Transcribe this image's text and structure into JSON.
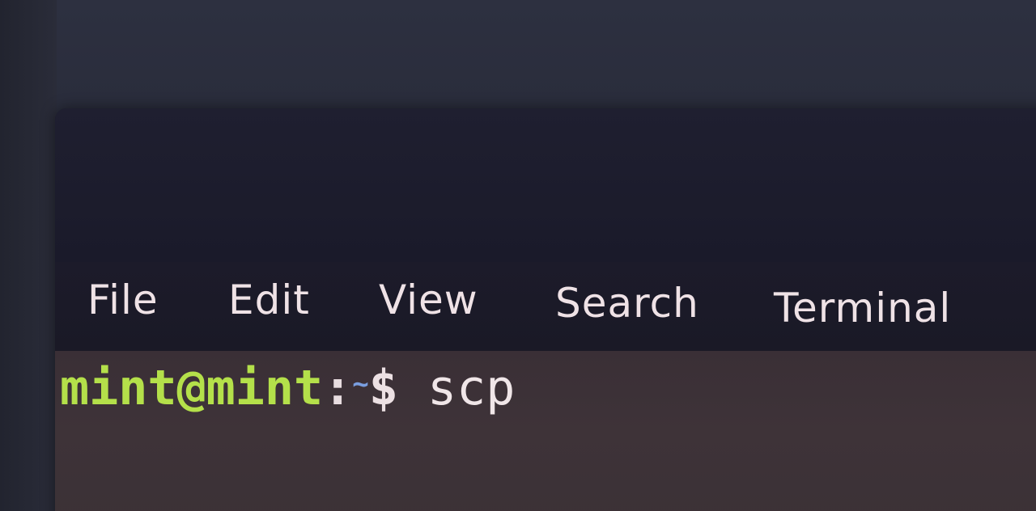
{
  "menu": {
    "items": [
      {
        "label": "File"
      },
      {
        "label": "Edit"
      },
      {
        "label": "View"
      },
      {
        "label": "Search"
      },
      {
        "label": "Terminal"
      }
    ]
  },
  "terminal": {
    "prompt_user_host": "mint@mint",
    "prompt_separator": ":",
    "prompt_path": "~",
    "prompt_symbol": "$",
    "command": "scp"
  },
  "colors": {
    "prompt_user": "#b4e04a",
    "prompt_path": "#7a9ee0",
    "menu_text": "#efe2e6",
    "terminal_bg": "#3e3338",
    "menubar_bg": "#1a1926"
  }
}
